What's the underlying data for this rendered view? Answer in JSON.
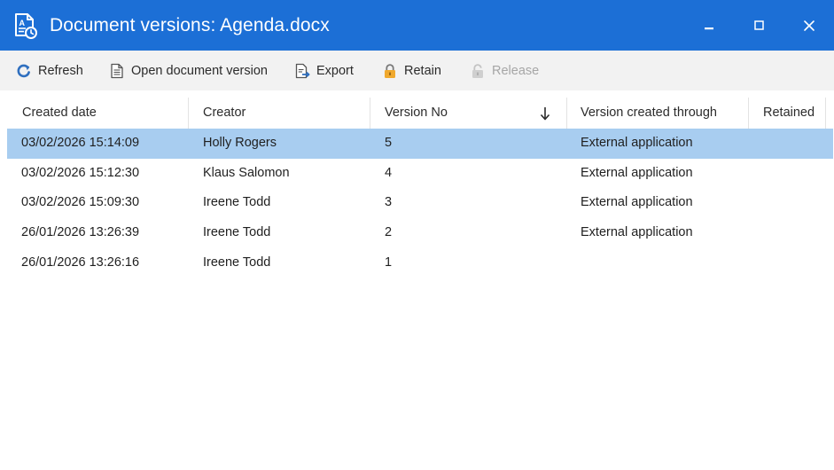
{
  "window": {
    "title": "Document versions: Agenda.docx"
  },
  "toolbar": {
    "refresh": "Refresh",
    "open": "Open document version",
    "export": "Export",
    "retain": "Retain",
    "release": "Release"
  },
  "grid": {
    "columns": [
      "Created date",
      "Creator",
      "Version No",
      "Version created through",
      "Retained"
    ],
    "sort_column": "Version No",
    "sort_direction": "descending",
    "selected_row": 0,
    "rows": [
      {
        "created": "03/02/2026 15:14:09",
        "creator": "Holly Rogers",
        "version": "5",
        "through": "External application",
        "retained": ""
      },
      {
        "created": "03/02/2026 15:12:30",
        "creator": "Klaus Salomon",
        "version": "4",
        "through": "External application",
        "retained": ""
      },
      {
        "created": "03/02/2026 15:09:30",
        "creator": "Ireene Todd",
        "version": "3",
        "through": "External application",
        "retained": ""
      },
      {
        "created": "26/01/2026 13:26:39",
        "creator": "Ireene Todd",
        "version": "2",
        "through": "External application",
        "retained": ""
      },
      {
        "created": "26/01/2026 13:26:16",
        "creator": "Ireene Todd",
        "version": "1",
        "through": "",
        "retained": ""
      }
    ]
  },
  "colors": {
    "titlebar": "#1c6fd6",
    "toolbar": "#f2f2f2",
    "selection": "#a8cdf0",
    "disabled_text": "#a6a6a6"
  },
  "icons": {
    "app": "document-versions-icon",
    "refresh": "refresh-icon",
    "open": "document-icon",
    "export": "export-icon",
    "retain": "lock-icon",
    "release": "unlock-icon"
  }
}
